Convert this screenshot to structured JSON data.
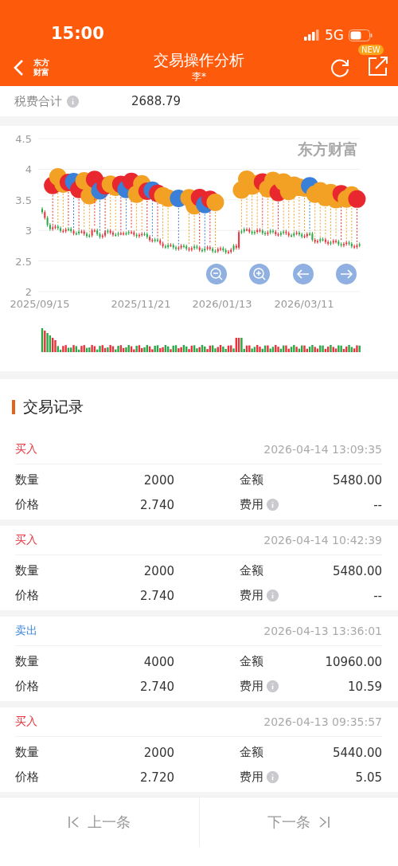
{
  "status_bar": {
    "time": "15:00",
    "network": "5G"
  },
  "nav": {
    "logo_lines": [
      "东方",
      "财富"
    ],
    "title": "交易操作分析",
    "subtitle": "李*",
    "badge": "NEW"
  },
  "summary": {
    "label": "税费合计",
    "value": "2688.79"
  },
  "chart": {
    "watermark": "东方财富",
    "yticks": [
      "4.5",
      "4",
      "3.5",
      "3",
      "2.5",
      "2"
    ],
    "xticks": [
      "2025/09/15",
      "2025/11/21",
      "2026/01/13",
      "2026/03/11"
    ]
  },
  "section_title": "交易记录",
  "records": [
    {
      "kind": "buy",
      "side": "买入",
      "time": "2026-04-14 13:09:35",
      "quantity_label": "数量",
      "quantity": "2000",
      "amount_label": "金额",
      "amount": "5480.00",
      "price_label": "价格",
      "price": "2.740",
      "fee_label": "费用",
      "fee": "--"
    },
    {
      "kind": "buy",
      "side": "买入",
      "time": "2026-04-14 10:42:39",
      "quantity_label": "数量",
      "quantity": "2000",
      "amount_label": "金额",
      "amount": "5480.00",
      "price_label": "价格",
      "price": "2.740",
      "fee_label": "费用",
      "fee": "--"
    },
    {
      "kind": "sell",
      "side": "卖出",
      "time": "2026-04-13 13:36:01",
      "quantity_label": "数量",
      "quantity": "4000",
      "amount_label": "金额",
      "amount": "10960.00",
      "price_label": "价格",
      "price": "2.740",
      "fee_label": "费用",
      "fee": "10.59"
    },
    {
      "kind": "buy",
      "side": "买入",
      "time": "2026-04-13 09:35:57",
      "quantity_label": "数量",
      "quantity": "2000",
      "amount_label": "金额",
      "amount": "5440.00",
      "price_label": "价格",
      "price": "2.720",
      "fee_label": "费用",
      "fee": "5.05"
    }
  ],
  "footer": {
    "prev": "上一条",
    "next": "下一条"
  }
}
